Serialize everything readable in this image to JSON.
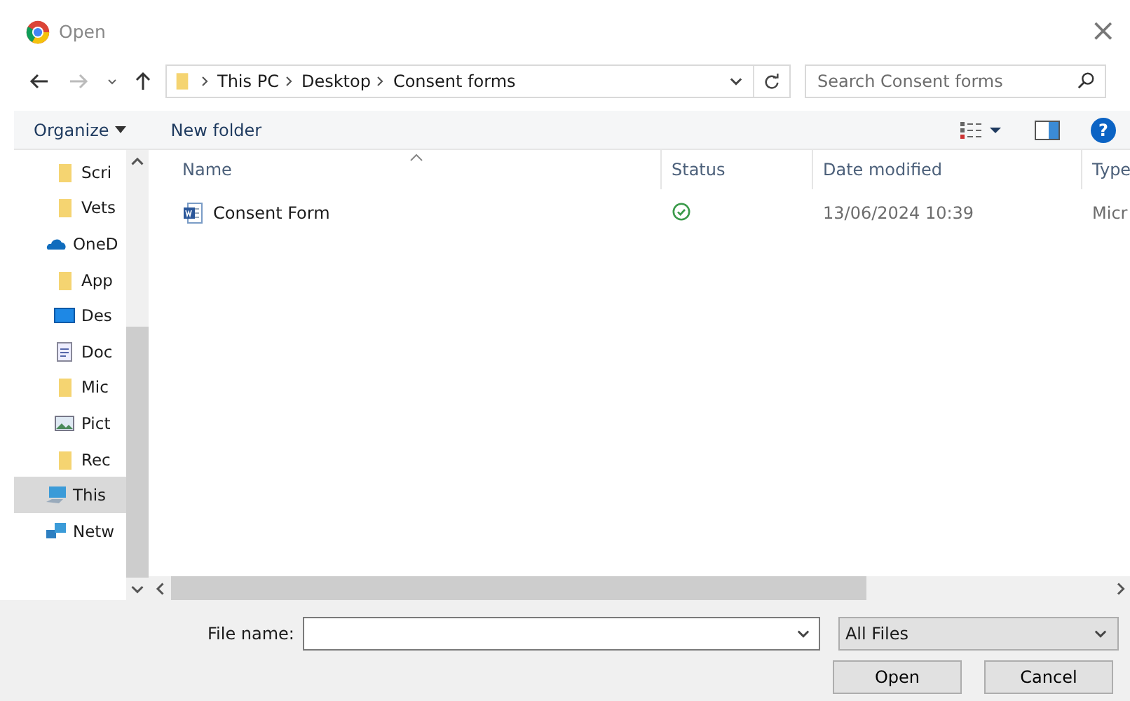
{
  "window": {
    "title": "Open",
    "close": "×"
  },
  "address": {
    "crumbs": [
      "This PC",
      "Desktop",
      "Consent forms"
    ],
    "search_placeholder": "Search Consent forms"
  },
  "toolbar": {
    "organize": "Organize",
    "new_folder": "New folder",
    "help": "?"
  },
  "sidebar": {
    "items": [
      {
        "label": "Scri",
        "kind": "folder",
        "selected": false
      },
      {
        "label": "Vets",
        "kind": "folder",
        "selected": false
      },
      {
        "label": "OneD",
        "kind": "cloud",
        "selected": false
      },
      {
        "label": "App",
        "kind": "folder",
        "selected": false
      },
      {
        "label": "Des",
        "kind": "desktop",
        "selected": false
      },
      {
        "label": "Doc",
        "kind": "document",
        "selected": false
      },
      {
        "label": "Mic",
        "kind": "folder",
        "selected": false
      },
      {
        "label": "Pict",
        "kind": "picture",
        "selected": false
      },
      {
        "label": "Rec",
        "kind": "folder",
        "selected": false
      },
      {
        "label": "This",
        "kind": "pc",
        "selected": true
      },
      {
        "label": "Netw",
        "kind": "network",
        "selected": false
      }
    ]
  },
  "table": {
    "columns": [
      "Name",
      "Status",
      "Date modified",
      "Type"
    ],
    "rows": [
      {
        "name": "Consent Form",
        "synced": true,
        "date": "13/06/2024 10:39",
        "type": "Micr"
      }
    ]
  },
  "footer": {
    "file_name_label": "File name:",
    "file_type": "All Files",
    "buttons": [
      "Open",
      "Cancel"
    ]
  }
}
